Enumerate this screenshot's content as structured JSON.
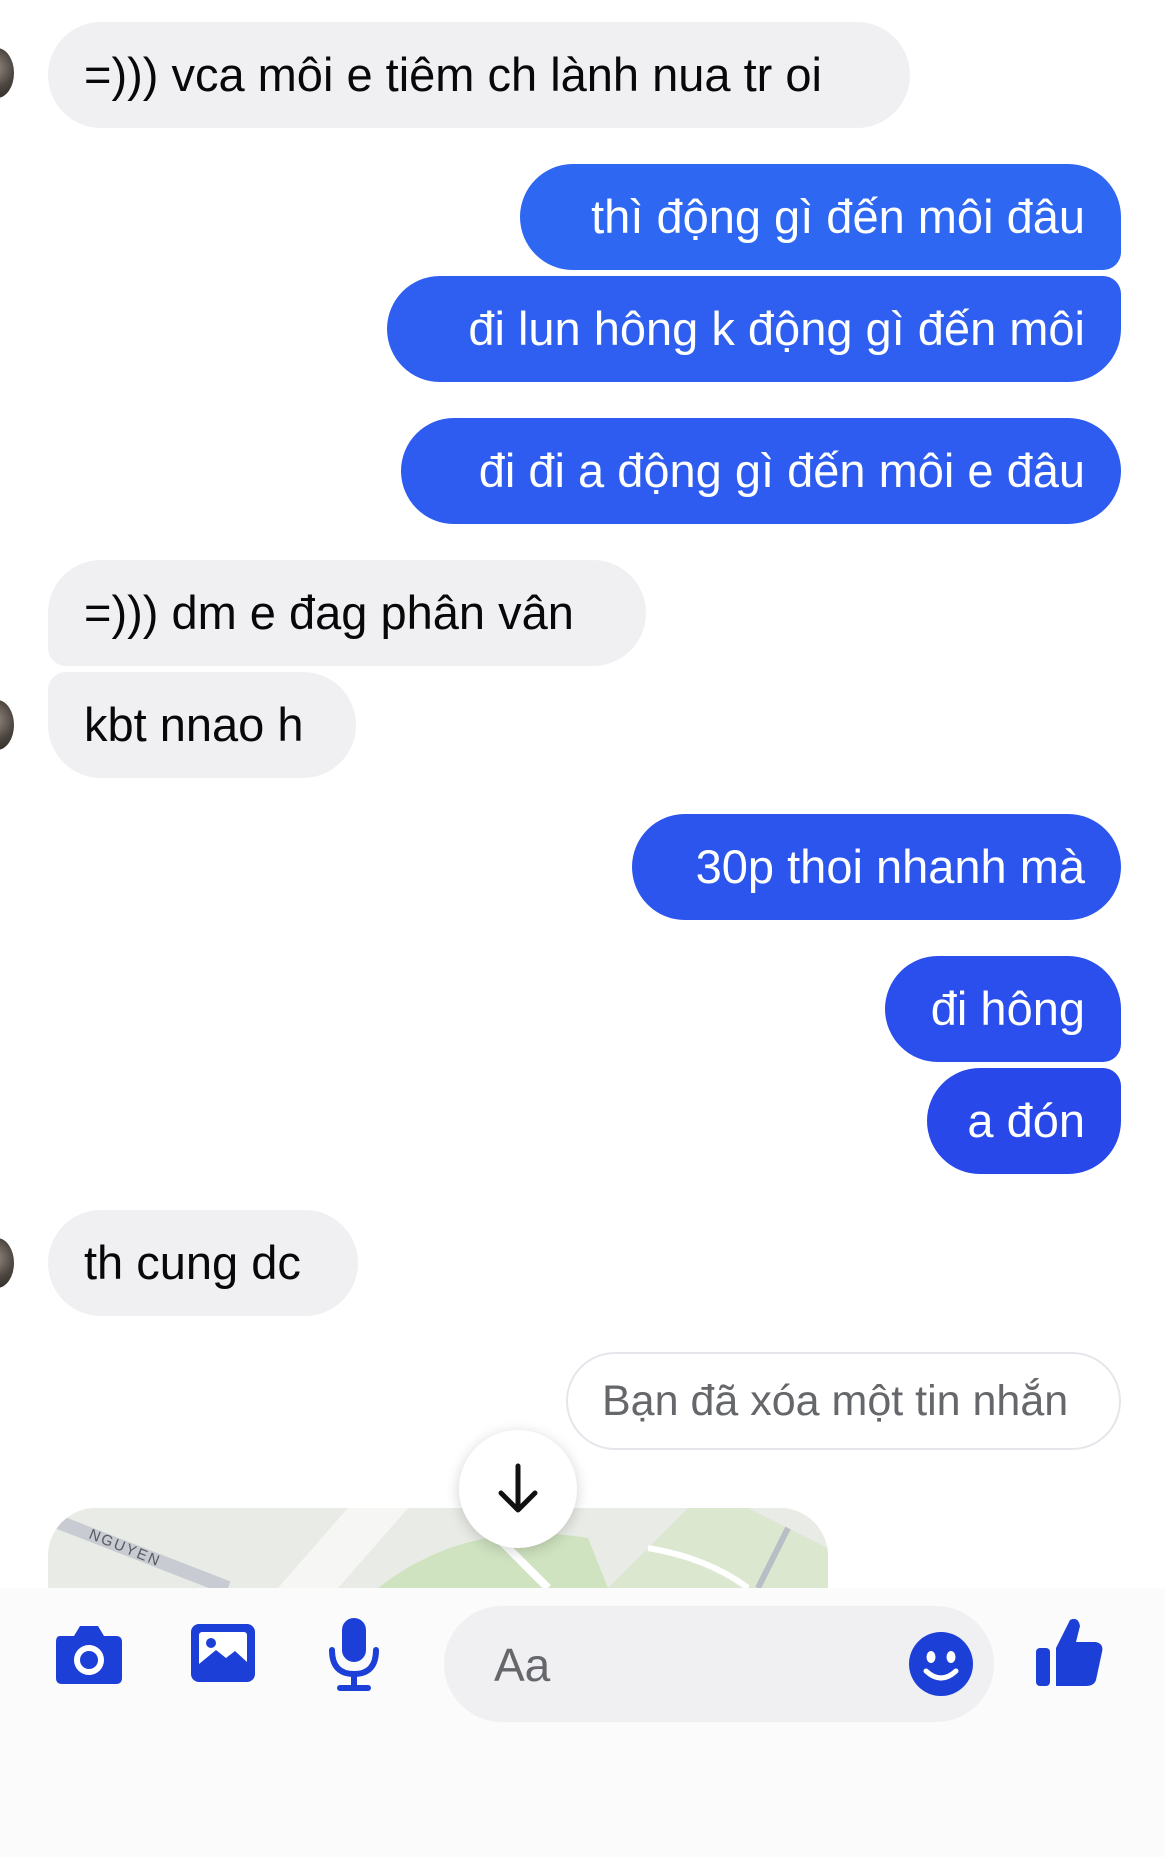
{
  "messages": [
    {
      "from": "them",
      "text": "=))) vca môi e tiêm ch lành nua tr oi"
    },
    {
      "from": "me",
      "text": "thì động gì đến môi đâu"
    },
    {
      "from": "me",
      "text": "đi lun hông k động gì đến môi"
    },
    {
      "from": "me",
      "text": "đi đi a động gì đến môi e đâu"
    },
    {
      "from": "them",
      "text": "=))) dm e đag phân vân"
    },
    {
      "from": "them",
      "text": "kbt nnao h"
    },
    {
      "from": "me",
      "text": "30p thoi nhanh mà"
    },
    {
      "from": "me",
      "text": "đi hông"
    },
    {
      "from": "me",
      "text": "a đón"
    },
    {
      "from": "them",
      "text": "th cung dc"
    }
  ],
  "deleted_notice": "Bạn đã xóa một tin nhắn",
  "map_preview": {
    "street_label": "NGUYEN"
  },
  "composer": {
    "placeholder": "Aa",
    "icons": [
      "camera-icon",
      "image-icon",
      "microphone-icon",
      "emoji-icon",
      "thumbs-up-icon"
    ]
  },
  "colors": {
    "outgoing_top": "#1877f2",
    "outgoing_bottom": "#1e39df",
    "incoming": "#f0f0f3",
    "icon_blue": "#1c3fd8"
  }
}
